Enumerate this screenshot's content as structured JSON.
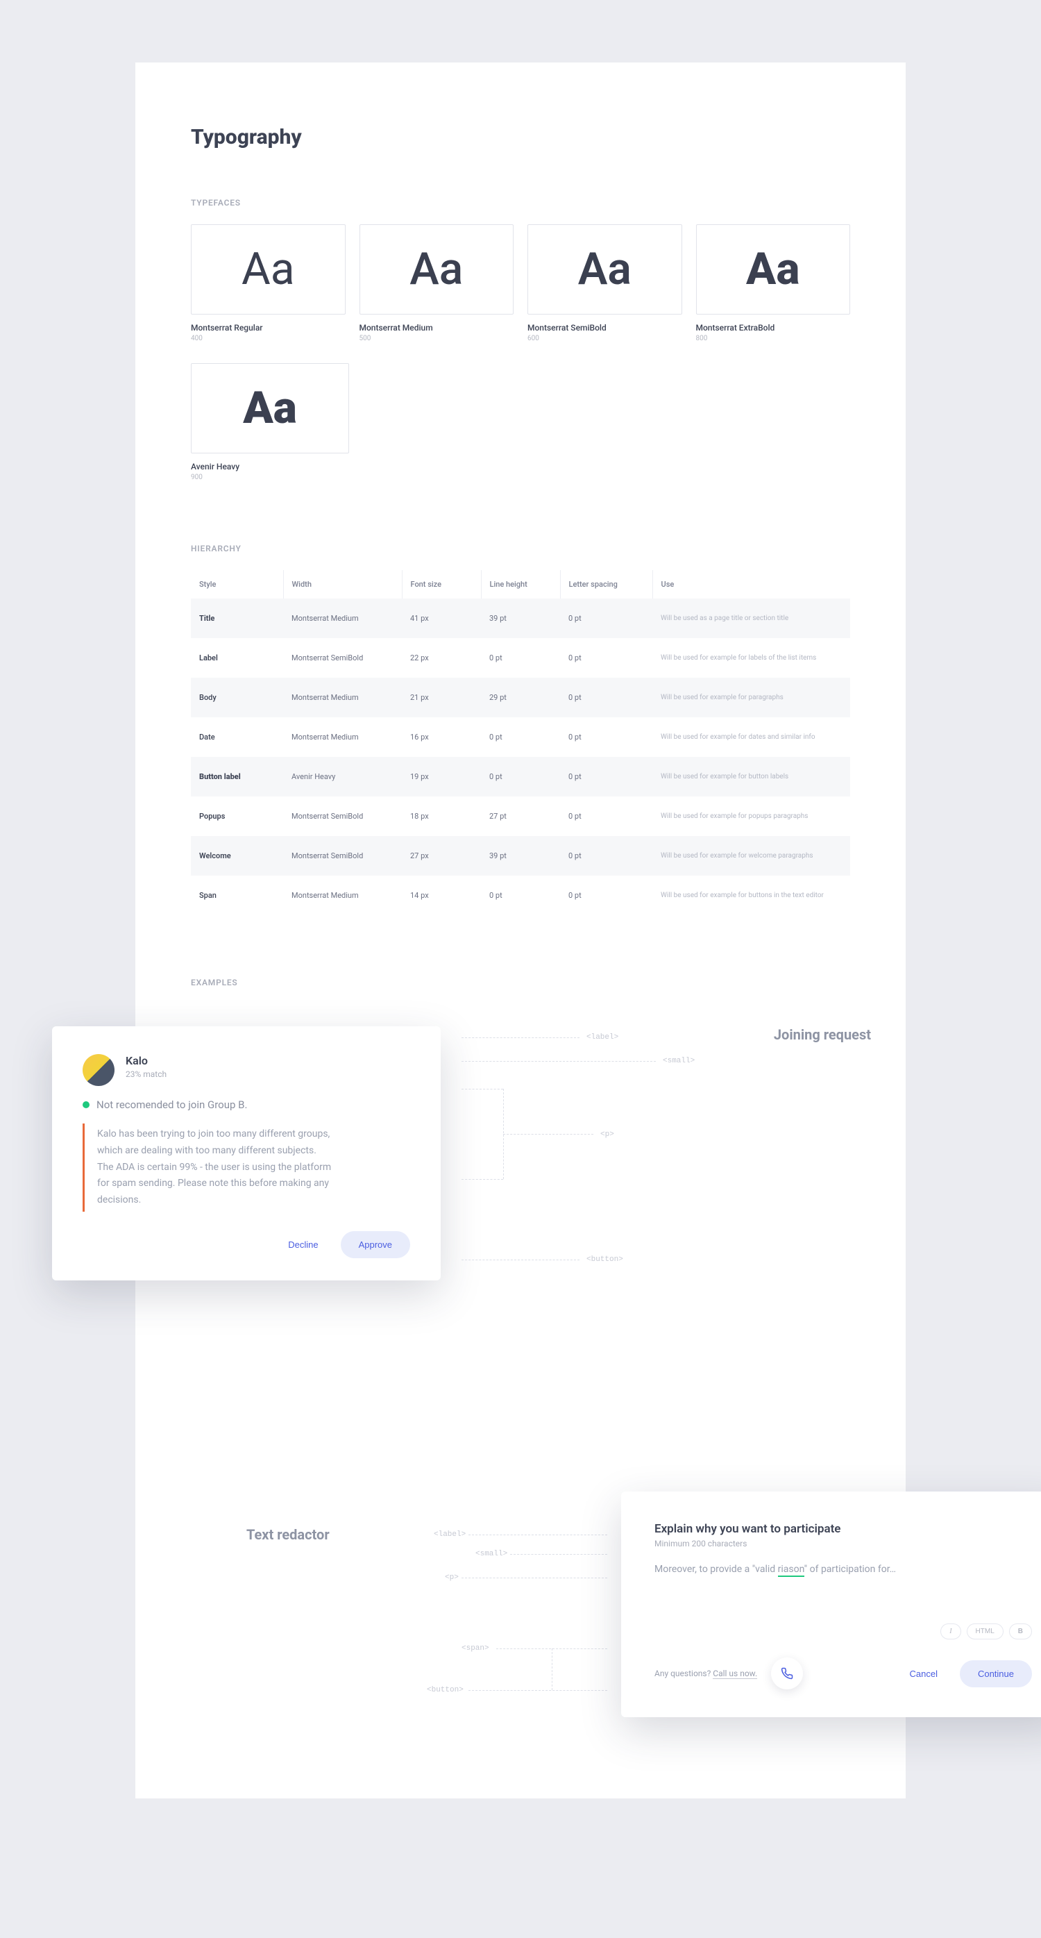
{
  "page": {
    "title": "Typography"
  },
  "sections": {
    "typefaces_label": "TYPEFACES",
    "hierarchy_label": "HIERARCHY",
    "examples_label": "EXAMPLES"
  },
  "typefaces": [
    {
      "glyph": "Aa",
      "name": "Montserrat Regular",
      "weight": "400",
      "fw": "fw-400"
    },
    {
      "glyph": "Aa",
      "name": "Montserrat Medium",
      "weight": "500",
      "fw": "fw-500"
    },
    {
      "glyph": "Aa",
      "name": "Montserrat SemiBold",
      "weight": "600",
      "fw": "fw-600"
    },
    {
      "glyph": "Aa",
      "name": "Montserrat ExtraBold",
      "weight": "800",
      "fw": "fw-800"
    },
    {
      "glyph": "Aa",
      "name": "Avenir Heavy",
      "weight": "900",
      "fw": "fw-900"
    }
  ],
  "hierarchy": {
    "columns": [
      "Style",
      "Width",
      "Font size",
      "Line height",
      "Letter spacing",
      "Use"
    ],
    "rows": [
      {
        "style": "Title",
        "style_class": "style-title",
        "width": "Montserrat Medium",
        "size": "41 px",
        "lh": "39 pt",
        "ls": "0 pt",
        "use": "Will be used as a page title or section title"
      },
      {
        "style": "Label",
        "style_class": "style-label",
        "width": "Montserrat SemiBold",
        "size": "22 px",
        "lh": "0 pt",
        "ls": "0 pt",
        "use": "Will be used for example for labels of the list items"
      },
      {
        "style": "Body",
        "style_class": "style-body",
        "width": "Montserrat Medium",
        "size": "21 px",
        "lh": "29 pt",
        "ls": "0 pt",
        "use": "Will be used for example for paragraphs"
      },
      {
        "style": "Date",
        "style_class": "style-date",
        "width": "Montserrat Medium",
        "size": "16 px",
        "lh": "0 pt",
        "ls": "0 pt",
        "use": "Will be used for example for dates and similar info"
      },
      {
        "style": "Button label",
        "style_class": "style-button",
        "width": "Avenir Heavy",
        "size": "19 px",
        "lh": "0 pt",
        "ls": "0 pt",
        "use": "Will be used for example for button labels"
      },
      {
        "style": "Popups",
        "style_class": "style-popups",
        "width": "Montserrat SemiBold",
        "size": "18 px",
        "lh": "27 pt",
        "ls": "0 pt",
        "use": "Will be used for example for popups paragraphs"
      },
      {
        "style": "Welcome",
        "style_class": "style-welcome",
        "width": "Montserrat SemiBold",
        "size": "27 px",
        "lh": "39 pt",
        "ls": "0 pt",
        "use": "Will be used for example for welcome paragraphs"
      },
      {
        "style": "Span",
        "style_class": "style-span",
        "width": "Montserrat Medium",
        "size": "14 px",
        "lh": "0 pt",
        "ls": "0 pt",
        "use": "Will be used for example for buttons in the text editor"
      }
    ]
  },
  "popup": {
    "name": "Kalo",
    "match": "23% match",
    "status": "Not recomended to join Group B.",
    "body": "Kalo has been trying to join too many different groups, which are dealing with too many different subjects. The ADA is certain 99% - the user is using the platform for spam sending. Please note this before making any decisions.",
    "decline": "Decline",
    "approve": "Approve"
  },
  "annot": {
    "title": "Joining request",
    "tags": {
      "label": "<label>",
      "small": "<small>",
      "p": "<p>",
      "button": "<button>",
      "span": "<span>"
    }
  },
  "redactor_zone": {
    "title": "Text redactor"
  },
  "redactor": {
    "heading": "Explain why you want to participate",
    "sub": "Minimum 200 characters",
    "text_pre": "Moreover, to provide a \"valid ",
    "text_under": "riason",
    "text_post": "\" of participation for…",
    "tools": {
      "italic": "I",
      "html": "HTML",
      "bold": "B"
    },
    "help_pre": "Any questions? ",
    "help_link": "Call us now.",
    "cancel": "Cancel",
    "continue": "Continue"
  }
}
